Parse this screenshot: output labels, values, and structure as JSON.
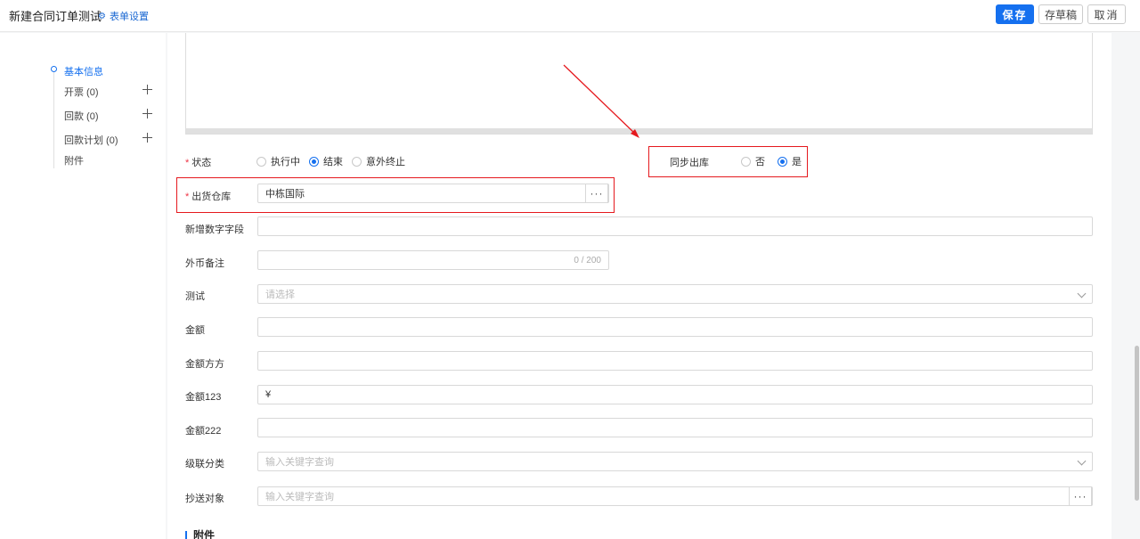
{
  "header": {
    "title": "新建合同订单测试",
    "form_settings": "表单设置",
    "save": "保存",
    "draft": "存草稿",
    "cancel": "取消"
  },
  "sidebar": {
    "items": [
      {
        "label": "基本信息"
      },
      {
        "label": "开票  (0)"
      },
      {
        "label": "回款  (0)"
      },
      {
        "label": "回款计划  (0)"
      },
      {
        "label": "附件"
      }
    ]
  },
  "form": {
    "status": {
      "label": "状态",
      "options": [
        "执行中",
        "结束",
        "意外终止"
      ],
      "selected": "结束"
    },
    "sync_outbound": {
      "label": "同步出库",
      "options": [
        "否",
        "是"
      ],
      "selected": "是"
    },
    "warehouse": {
      "label": "出货仓库",
      "value": "中栋国际",
      "button": "···"
    },
    "new_number_field": {
      "label": "新增数字字段",
      "value": ""
    },
    "fx_note": {
      "label": "外币备注",
      "value": "",
      "counter": "0 / 200"
    },
    "test": {
      "label": "测试",
      "placeholder": "请选择"
    },
    "amount": {
      "label": "金额",
      "value": ""
    },
    "amount_fangfang": {
      "label": "金额方方",
      "value": ""
    },
    "amount123": {
      "label": "金额123",
      "value": "¥"
    },
    "amount222": {
      "label": "金额222",
      "value": ""
    },
    "cascade": {
      "label": "级联分类",
      "placeholder": "输入关键字查询"
    },
    "cc": {
      "label": "抄送对象",
      "placeholder": "输入关键字查询",
      "button": "···"
    },
    "attachment_section": "附件"
  },
  "colors": {
    "primary": "#1570ef",
    "highlight": "#e5191e"
  }
}
